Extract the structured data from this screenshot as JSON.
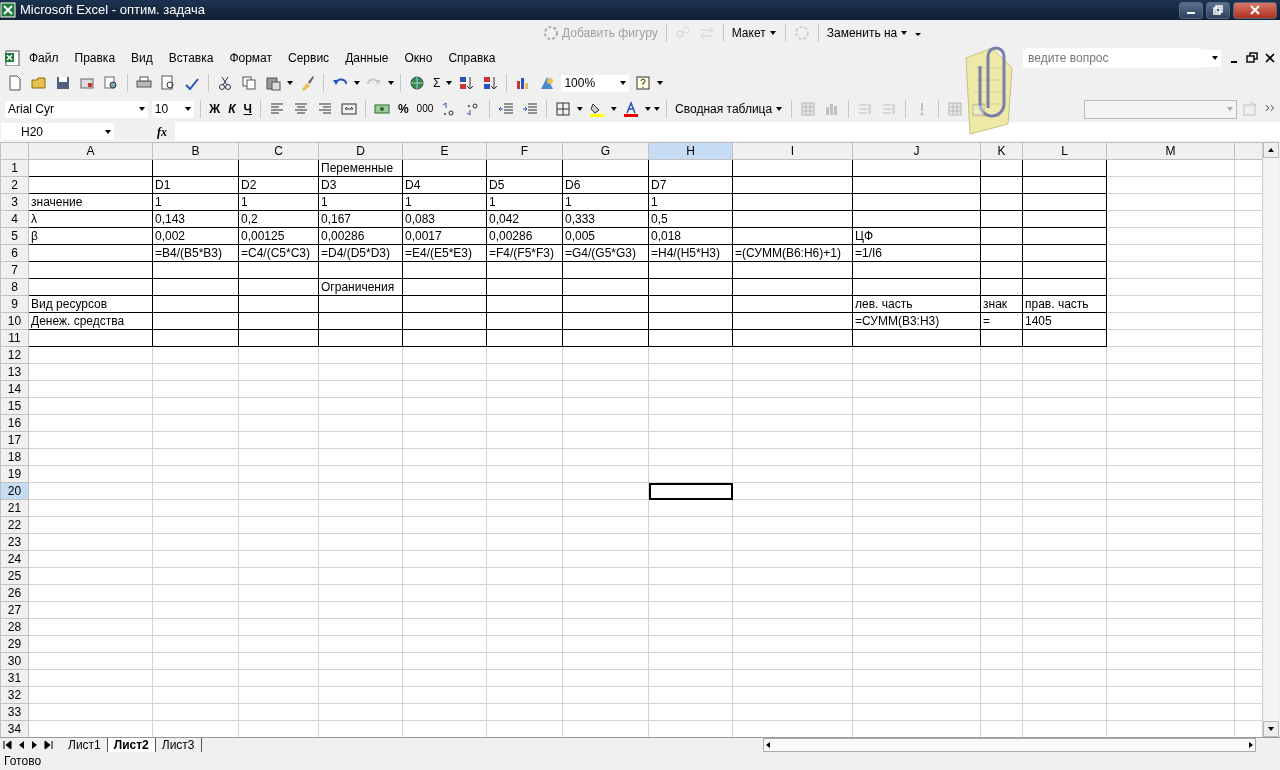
{
  "window": {
    "title": "Microsoft Excel - оптим. задача"
  },
  "drawing_toolbar": {
    "items": [
      {
        "kind": "button",
        "label": "Добавить фигуру",
        "disabled": true
      },
      {
        "kind": "menu",
        "label": "Макет",
        "disabled": false
      },
      {
        "kind": "menu",
        "label": "Заменить на",
        "disabled": false
      }
    ]
  },
  "menu_bar": {
    "items": [
      "Файл",
      "Правка",
      "Вид",
      "Вставка",
      "Формат",
      "Сервис",
      "Данные",
      "Окно",
      "Справка"
    ]
  },
  "help_box": {
    "placeholder": "ведите вопрос"
  },
  "standard_toolbar": {
    "sum_symbol": "Σ",
    "zoom": "100%"
  },
  "formatting_toolbar": {
    "font": "Arial Cyr",
    "size": "10",
    "bold": "Ж",
    "italic": "К",
    "underline": "Ч",
    "percent": "%",
    "thousands": "000",
    "pivot_table": "Сводная таблица"
  },
  "formula_bar": {
    "name_box": "H20",
    "function_label": "fx"
  },
  "sheet": {
    "columns": [
      {
        "label": "A",
        "selected": false,
        "bordered": true
      },
      {
        "label": "B",
        "selected": false,
        "bordered": true
      },
      {
        "label": "C",
        "selected": false,
        "bordered": true
      },
      {
        "label": "D",
        "selected": false,
        "bordered": true
      },
      {
        "label": "E",
        "selected": false,
        "bordered": true
      },
      {
        "label": "F",
        "selected": false,
        "bordered": true
      },
      {
        "label": "G",
        "selected": false,
        "bordered": true
      },
      {
        "label": "H",
        "selected": true,
        "bordered": true
      },
      {
        "label": "I",
        "selected": false,
        "bordered": true
      },
      {
        "label": "J",
        "selected": false,
        "bordered": true
      },
      {
        "label": "K",
        "selected": false,
        "bordered": true
      },
      {
        "label": "L",
        "selected": false,
        "bordered": true
      },
      {
        "label": "M",
        "selected": false,
        "bordered": false
      }
    ],
    "rows": [
      {
        "label": "1",
        "selected": false,
        "bordered": true,
        "cells": {
          "D": "Переменные"
        }
      },
      {
        "label": "2",
        "selected": false,
        "bordered": true,
        "cells": {
          "B": "D1",
          "C": "D2",
          "D": "D3",
          "E": "D4",
          "F": "D5",
          "G": "D6",
          "H": "D7"
        }
      },
      {
        "label": "3",
        "selected": false,
        "bordered": true,
        "cells": {
          "A": "значение",
          "B": "1",
          "C": "1",
          "D": "1",
          "E": "1",
          "F": "1",
          "G": "1",
          "H": "1"
        }
      },
      {
        "label": "4",
        "selected": false,
        "bordered": true,
        "cells": {
          "A": "λ",
          "B": "0,143",
          "C": "0,2",
          "D": "0,167",
          "E": "0,083",
          "F": "0,042",
          "G": "0,333",
          "H": "0,5"
        }
      },
      {
        "label": "5",
        "selected": false,
        "bordered": true,
        "cells": {
          "A": "β",
          "B": "0,002",
          "C": "0,00125",
          "D": "0,00286",
          "E": "0,0017",
          "F": "0,00286",
          "G": "0,005",
          "H": "0,018",
          "J": "ЦФ"
        }
      },
      {
        "label": "6",
        "selected": false,
        "bordered": true,
        "cells": {
          "B": "=B4/(B5*B3)",
          "C": "=C4/(C5*C3)",
          "D": "=D4/(D5*D3)",
          "E": "=E4/(E5*E3)",
          "F": "=F4/(F5*F3)",
          "G": "=G4/(G5*G3)",
          "H": "=H4/(H5*H3)",
          "I": "=(СУММ(B6:H6)+1)",
          "J": "=1/I6"
        }
      },
      {
        "label": "7",
        "selected": false,
        "bordered": true,
        "cells": {}
      },
      {
        "label": "8",
        "selected": false,
        "bordered": true,
        "cells": {
          "D": "Ограничения"
        }
      },
      {
        "label": "9",
        "selected": false,
        "bordered": true,
        "cells": {
          "A": "Вид ресурсов",
          "J": "лев. часть",
          "K": "знак",
          "L": "прав. часть"
        }
      },
      {
        "label": "10",
        "selected": false,
        "bordered": true,
        "cells": {
          "A": "Денеж. средства",
          "J": "=СУММ(B3:H3)",
          "K": "=",
          "L": "1405"
        }
      },
      {
        "label": "11",
        "selected": false,
        "bordered": true,
        "cells": {}
      },
      {
        "label": "12",
        "selected": false,
        "bordered": false,
        "cells": {}
      },
      {
        "label": "13",
        "selected": false,
        "bordered": false,
        "cells": {}
      },
      {
        "label": "14",
        "selected": false,
        "bordered": false,
        "cells": {}
      },
      {
        "label": "15",
        "selected": false,
        "bordered": false,
        "cells": {}
      },
      {
        "label": "16",
        "selected": false,
        "bordered": false,
        "cells": {}
      },
      {
        "label": "17",
        "selected": false,
        "bordered": false,
        "cells": {}
      },
      {
        "label": "18",
        "selected": false,
        "bordered": false,
        "cells": {}
      },
      {
        "label": "19",
        "selected": false,
        "bordered": false,
        "cells": {}
      },
      {
        "label": "20",
        "selected": true,
        "bordered": false,
        "cells": {}
      },
      {
        "label": "21",
        "selected": false,
        "bordered": false,
        "cells": {}
      },
      {
        "label": "22",
        "selected": false,
        "bordered": false,
        "cells": {}
      },
      {
        "label": "23",
        "selected": false,
        "bordered": false,
        "cells": {}
      },
      {
        "label": "24",
        "selected": false,
        "bordered": false,
        "cells": {}
      },
      {
        "label": "25",
        "selected": false,
        "bordered": false,
        "cells": {}
      },
      {
        "label": "26",
        "selected": false,
        "bordered": false,
        "cells": {}
      },
      {
        "label": "27",
        "selected": false,
        "bordered": false,
        "cells": {}
      },
      {
        "label": "28",
        "selected": false,
        "bordered": false,
        "cells": {}
      },
      {
        "label": "29",
        "selected": false,
        "bordered": false,
        "cells": {}
      },
      {
        "label": "30",
        "selected": false,
        "bordered": false,
        "cells": {}
      },
      {
        "label": "31",
        "selected": false,
        "bordered": false,
        "cells": {}
      },
      {
        "label": "32",
        "selected": false,
        "bordered": false,
        "cells": {}
      },
      {
        "label": "33",
        "selected": false,
        "bordered": false,
        "cells": {}
      },
      {
        "label": "34",
        "selected": false,
        "bordered": false,
        "cells": {}
      }
    ]
  },
  "sheet_tabs": [
    {
      "label": "Лист1",
      "selected": false
    },
    {
      "label": "Лист2",
      "selected": true
    },
    {
      "label": "Лист3",
      "selected": false
    }
  ],
  "status_bar": {
    "text": "Готово"
  }
}
